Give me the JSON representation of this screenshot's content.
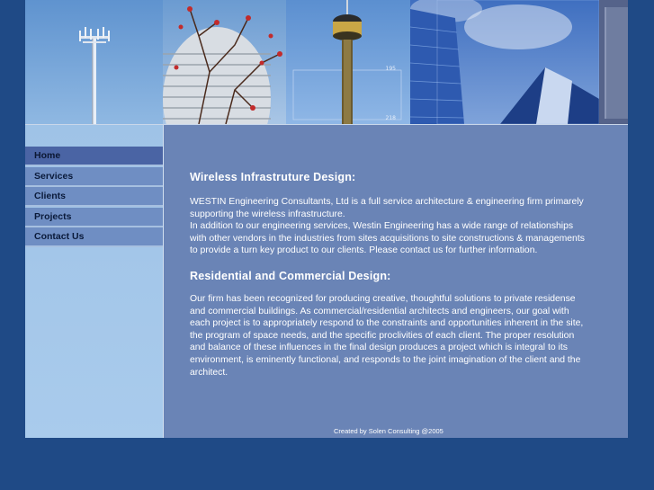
{
  "banner": {
    "images": [
      "cell-tower",
      "round-building",
      "sydney-tower",
      "glass-skyscraper"
    ]
  },
  "nav": {
    "items": [
      {
        "label": "Home",
        "active": true
      },
      {
        "label": "Services",
        "active": false
      },
      {
        "label": "Clients",
        "active": false
      },
      {
        "label": "Projects",
        "active": false
      },
      {
        "label": "Contact Us",
        "active": false
      }
    ]
  },
  "content": {
    "wireless": {
      "heading": "Wireless Infrastruture Design:",
      "lines": [
        "WESTIN Engineering Consultants, Ltd is a full service architecture & engineering firm primarely",
        "supporting the wireless infrastructure.",
        "In addition to our engineering services, Westin Engineering has a wide range of relationships",
        "with other vendors in the industries from sites acquisitions to site constructions & managements",
        "to provide a turn key product to our clients. Please contact us for further information."
      ]
    },
    "residential": {
      "heading": "Residential and Commercial Design:",
      "lines": [
        "Our firm has been recognized for producing creative, thoughtful solutions to private residense",
        "and commercial buildings. As commercial/residential architects and engineers, our goal with",
        "each project is to appropriately respond to the constraints and opportunities inherent in the site,",
        "the program of space needs, and the specific proclivities of each client. The proper resolution",
        "and balance of these influences in the final design produces a project which is integral to its",
        "environment, is eminently functional, and responds to the joint imagination of the client and the",
        "architect."
      ]
    }
  },
  "footer": {
    "credit": "Created by Solen Consulting @2005"
  },
  "colors": {
    "background": "#1f4a86",
    "content_bg": "#6a84b6",
    "sidebar_bg": "#a9cbec",
    "nav_bg": "#6f8ec3",
    "nav_active_bg": "#4a64a4"
  }
}
